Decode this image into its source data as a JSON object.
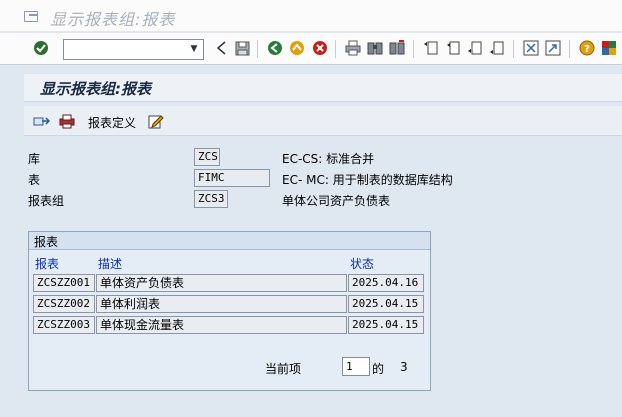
{
  "window": {
    "title": "显示报表组:报表"
  },
  "toolbar": {
    "command_value": "",
    "icons": [
      "enter-icon",
      "dropdown-icon",
      "back-arrow-icon",
      "save-icon",
      "back-icon",
      "exit-icon",
      "cancel-icon",
      "print-icon",
      "find-icon",
      "find-next-icon",
      "first-page-icon",
      "previous-page-icon",
      "next-page-icon",
      "last-page-icon",
      "new-session-icon",
      "shortcut-icon",
      "help-icon",
      "customize-layout-icon"
    ]
  },
  "screen": {
    "title": "显示报表组:报表"
  },
  "app_toolbar": {
    "report_def_label": "报表定义",
    "icons": [
      "export-icon",
      "print-preview-icon",
      "edit-icon"
    ]
  },
  "header": {
    "library": {
      "label": "库",
      "value": "ZCS",
      "desc": "EC-CS: 标准合并"
    },
    "table": {
      "label": "表",
      "value": "FIMC",
      "desc": "EC- MC: 用于制表的数据库结构"
    },
    "report_group": {
      "label": "报表组",
      "value": "ZCS3",
      "desc": "单体公司资产负债表"
    }
  },
  "reports": {
    "title": "报表",
    "columns": {
      "report": "报表",
      "description": "描述",
      "status": "状态"
    },
    "rows": [
      {
        "report": "ZCSZZ001",
        "description": "单体资产负债表",
        "status": "2025.04.16"
      },
      {
        "report": "ZCSZZ002",
        "description": "单体利润表",
        "status": "2025.04.15"
      },
      {
        "report": "ZCSZZ003",
        "description": "单体现金流量表",
        "status": "2025.04.15"
      }
    ],
    "pager": {
      "label": "当前项",
      "current": "1",
      "of_label": "的",
      "total": "3"
    }
  },
  "colors": {
    "background": "#dfe7f1",
    "header_blue": "#0a30b0",
    "title_text": "#1a2a44"
  }
}
